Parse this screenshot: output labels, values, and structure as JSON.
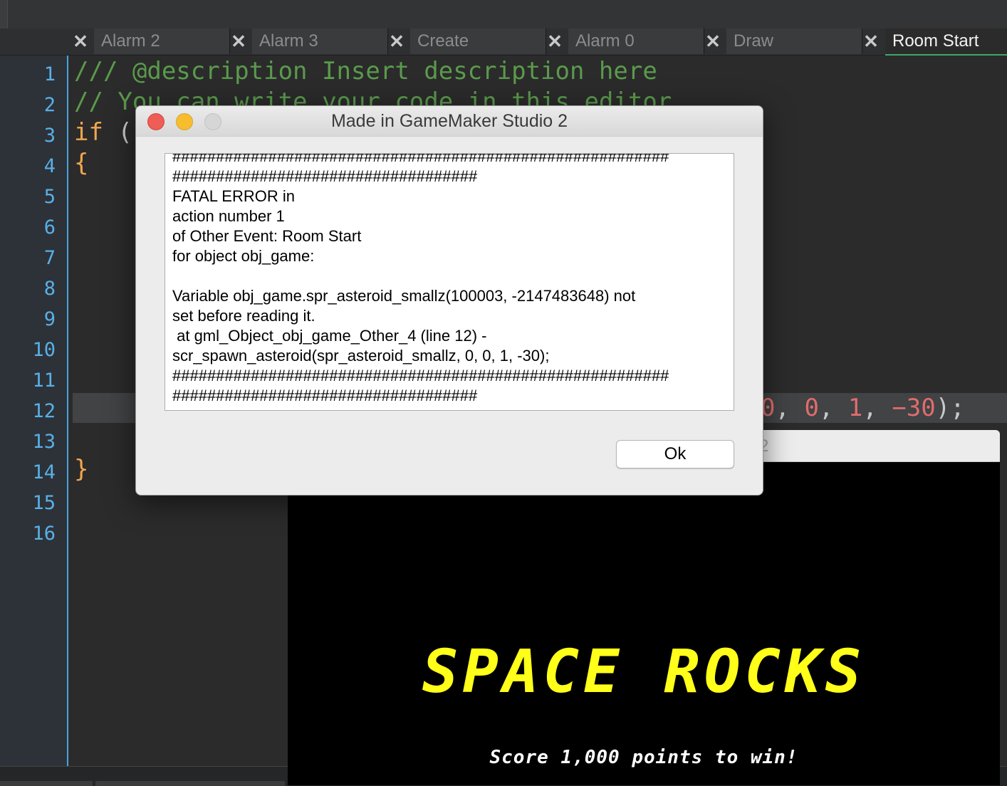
{
  "editor": {
    "tabs": [
      {
        "label": "Alarm 2",
        "active": false
      },
      {
        "label": "Alarm 3",
        "active": false
      },
      {
        "label": "Create",
        "active": false
      },
      {
        "label": "Alarm 0",
        "active": false
      },
      {
        "label": "Draw",
        "active": false
      },
      {
        "label": "Room Start",
        "active": true
      }
    ],
    "close_glyph": "✕",
    "line_numbers": [
      "1",
      "2",
      "3",
      "4",
      "5",
      "6",
      "7",
      "8",
      "9",
      "10",
      "11",
      "12",
      "13",
      "14",
      "15",
      "16"
    ],
    "code": {
      "line1": "/// @description Insert description here",
      "line2": "// You can write your code in this editor",
      "line3_kw": "if",
      "line3_rest": " (",
      "line4": "{",
      "line12_a": "0",
      "line12_b": ", ",
      "line12_c": "0",
      "line12_d": ", ",
      "line12_e": "1",
      "line12_f": ", ",
      "line12_g": "−30",
      "line12_h": ");",
      "line14": "}"
    }
  },
  "dialog": {
    "title": "Made in GameMaker Studio 2",
    "message_lines": [
      "#########################################################",
      "###################################",
      "FATAL ERROR in",
      "action number 1",
      "of Other Event: Room Start",
      "for object obj_game:",
      "",
      "Variable obj_game.spr_asteroid_smallz(100003, -2147483648) not",
      "set before reading it.",
      " at gml_Object_obj_game_Other_4 (line 12) -",
      "scr_spawn_asteroid(spr_asteroid_smallz, 0, 0, 1, -30);",
      "#########################################################",
      "###################################"
    ],
    "ok_label": "Ok",
    "colors": {
      "close": "#ee5d56",
      "minimize": "#f6be2f",
      "zoom": "#d6d6d6"
    }
  },
  "game": {
    "title_fragment": "2",
    "heading": "SPACE ROCKS",
    "subtitle": "Score 1,000 points to win!",
    "colors": {
      "heading": "#ffff1a",
      "subtitle": "#ffffff",
      "background": "#000000"
    }
  }
}
